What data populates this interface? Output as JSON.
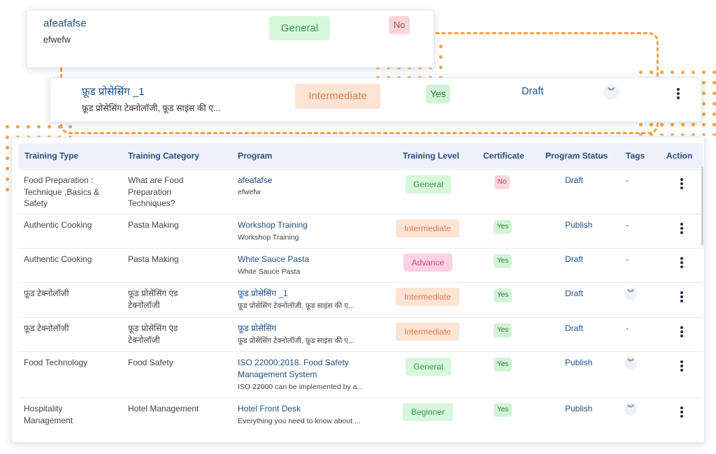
{
  "colors": {
    "accent": "#f2a445",
    "link": "#1e4f86",
    "header_bg": "#eef1fb"
  },
  "preview_card_1": {
    "program_title": "afeafafse",
    "program_sub": "efwefw",
    "level": "General",
    "certificate": "No"
  },
  "preview_card_2": {
    "program_title": "फ़ूड प्रोसेसिंग _1",
    "program_sub": "फ़ूड प्रोसेसिंग टेक्नोलॉजी, फ़ूड साइंस की ए...",
    "level": "Intermediate",
    "certificate": "Yes",
    "status": "Draft",
    "tags_icon": "chevron-double-down-icon",
    "action_icon": "kebab-menu-icon"
  },
  "table": {
    "headers": {
      "training_type": "Training Type",
      "training_category": "Training Category",
      "program": "Program",
      "training_level": "Training Level",
      "certificate": "Certificate",
      "program_status": "Program Status",
      "tags": "Tags",
      "action": "Action"
    },
    "rows": [
      {
        "type": "Food Preparation : Technique ,Basics & Safety",
        "category": "What are Food Preparation Techniques?",
        "program": "afeafafse",
        "program_sub": "efwefw",
        "level": "General",
        "cert": "No",
        "status": "Draft",
        "tags": "-"
      },
      {
        "type": "Authentic Cooking",
        "category": "Pasta Making",
        "program": "Workshop Training",
        "program_sub": "Workshop Training",
        "level": "Intermediate",
        "cert": "Yes",
        "status": "Publish",
        "tags": "-"
      },
      {
        "type": "Authentic Cooking",
        "category": "Pasta Making",
        "program": "White Sauce Pasta",
        "program_sub": "White Sauce Pasta",
        "level": "Advance",
        "cert": "Yes",
        "status": "Draft",
        "tags": "-"
      },
      {
        "type": "फ़ूड टेक्नोलॉजी",
        "category": "फ़ूड प्रोसेसिंग एंड टेक्नोलॉजी",
        "program": "फ़ूड प्रोसेसिंग _1",
        "program_sub": "फ़ूड प्रोसेसिंग टेक्नोलॉजी, फ़ूड साइंस की ए...",
        "level": "Intermediate",
        "cert": "Yes",
        "status": "Draft",
        "tags": ""
      },
      {
        "type": "फ़ूड टेक्नोलॉजी",
        "category": "फ़ूड प्रोसेसिंग एंड टेक्नोलॉजी",
        "program": "फ़ूड प्रोसेसिंग",
        "program_sub": "फ़ूड प्रोसेसिंग टेक्नोलॉजी, फ़ूड साइंस की ए...",
        "level": "Intermediate",
        "cert": "Yes",
        "status": "Draft",
        "tags": "-"
      },
      {
        "type": "Food Technology",
        "category": "Food Safety",
        "program": "ISO 22000:2018. Food Safety Management System",
        "program_sub": "ISO 22000 can be implemented by a...",
        "level": "General",
        "cert": "Yes",
        "status": "Publish",
        "tags": ""
      },
      {
        "type": "Hospitality Management",
        "category": "Hotel Management",
        "program": "Hotel Front Desk",
        "program_sub": "Everything you need to know about ...",
        "level": "Beginner",
        "cert": "Yes",
        "status": "Publish",
        "tags": ""
      }
    ]
  }
}
